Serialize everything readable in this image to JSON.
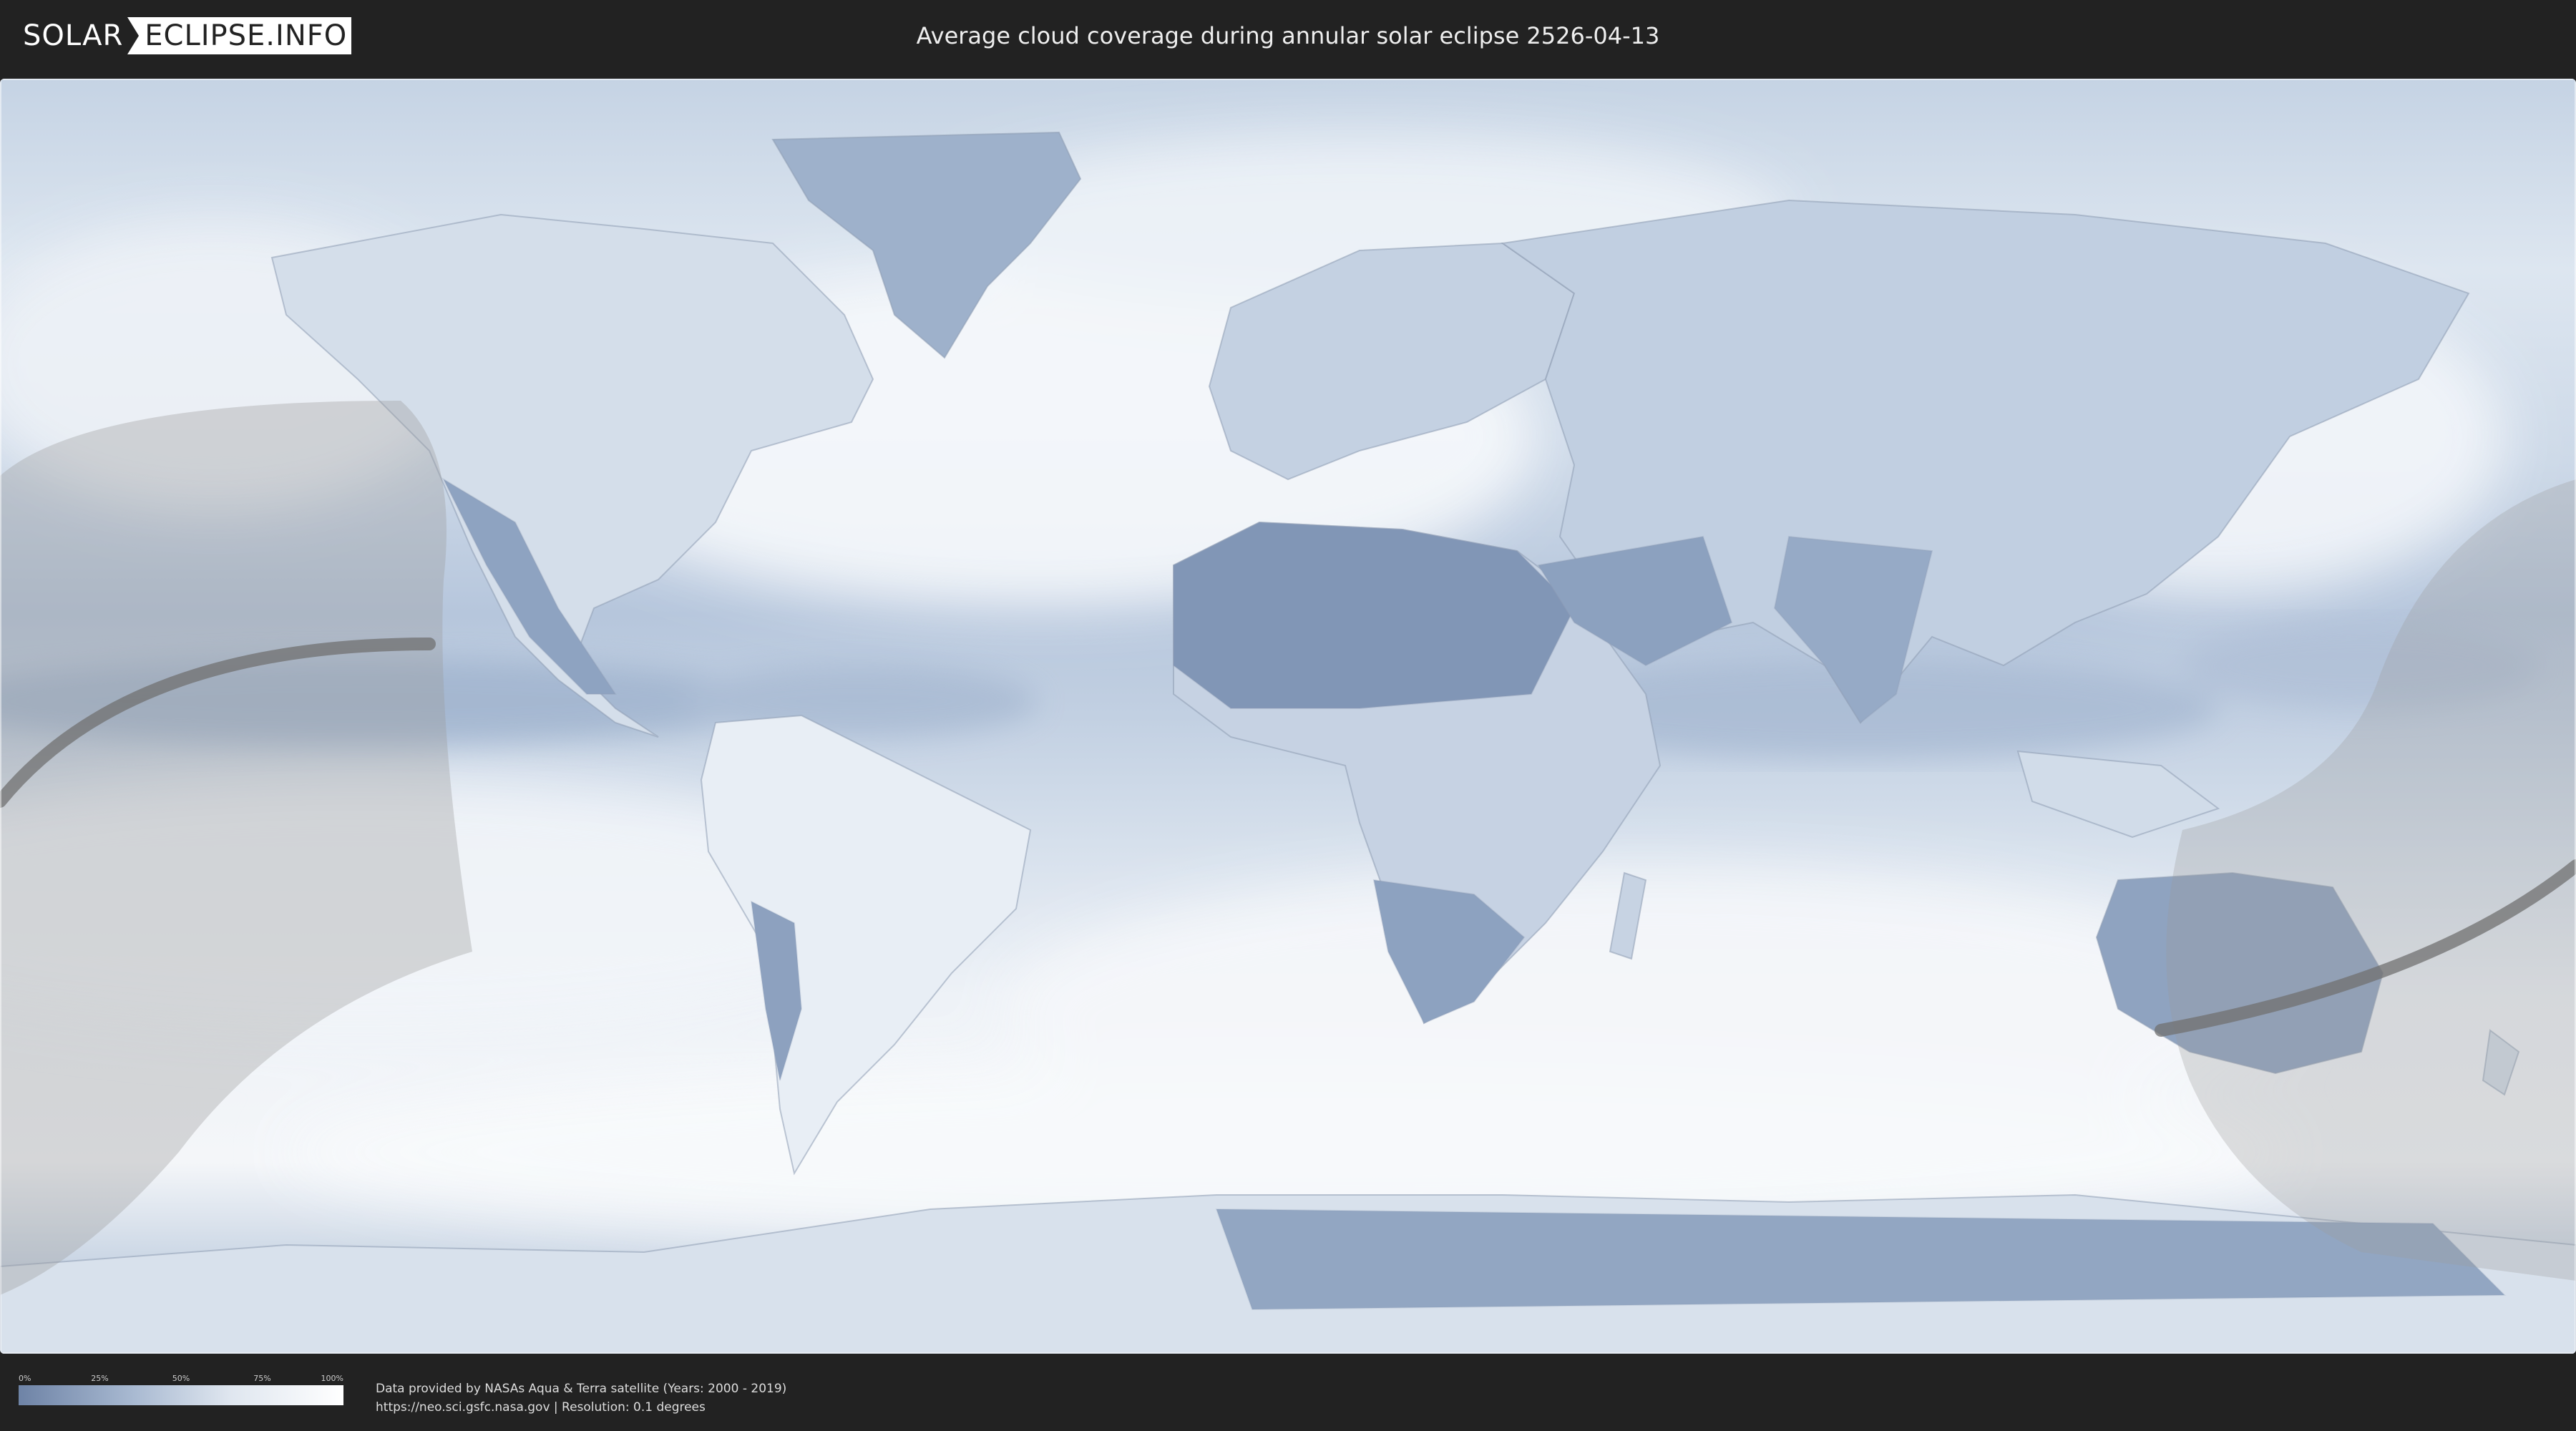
{
  "header": {
    "logo_left": "SOLAR",
    "logo_right": "ECLIPSE.INFO",
    "title": "Average cloud coverage during annular solar eclipse 2526-04-13"
  },
  "map": {
    "layer": "cloud-coverage",
    "colors": {
      "clear": "#6e83a6",
      "mid": "#a8b9d1",
      "cloudy": "#ffffff",
      "eclipse_overlay": "#9a9a9a",
      "central_line": "#6f6f6f"
    }
  },
  "legend": {
    "ticks": [
      "0%",
      "25%",
      "50%",
      "75%",
      "100%"
    ],
    "tick_values": [
      0,
      0.25,
      0.5,
      0.75,
      1.0
    ]
  },
  "footer": {
    "source_line": "Data provided by NASAs Aqua & Terra satellite (Years: 2000 - 2019)",
    "url_line": "https://neo.sci.gsfc.nasa.gov | Resolution: 0.1 degrees"
  }
}
